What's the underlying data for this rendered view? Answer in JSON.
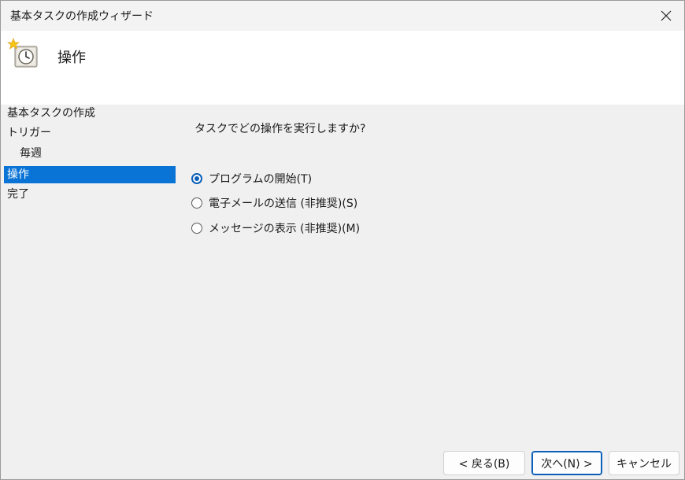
{
  "window": {
    "title": "基本タスクの作成ウィザード",
    "close_glyph": "✕"
  },
  "header": {
    "heading": "操作",
    "icon": "task-clock-icon"
  },
  "nav": {
    "items": [
      {
        "label": "基本タスクの作成"
      },
      {
        "label": "トリガー"
      },
      {
        "label": "毎週"
      },
      {
        "label": "操作"
      },
      {
        "label": "完了"
      }
    ],
    "selected": "操作"
  },
  "content": {
    "question": "タスクでどの操作を実行しますか?",
    "options": [
      {
        "label": "プログラムの開始(T)",
        "checked": true
      },
      {
        "label": "電子メールの送信 (非推奨)(S)",
        "checked": false
      },
      {
        "label": "メッセージの表示 (非推奨)(M)",
        "checked": false
      }
    ]
  },
  "buttons": {
    "back": "< 戻る(B)",
    "next": "次へ(N) >",
    "cancel": "キャンセル"
  },
  "colors": {
    "accent": "#0a74d6",
    "radio_accent": "#0a5fb8"
  }
}
